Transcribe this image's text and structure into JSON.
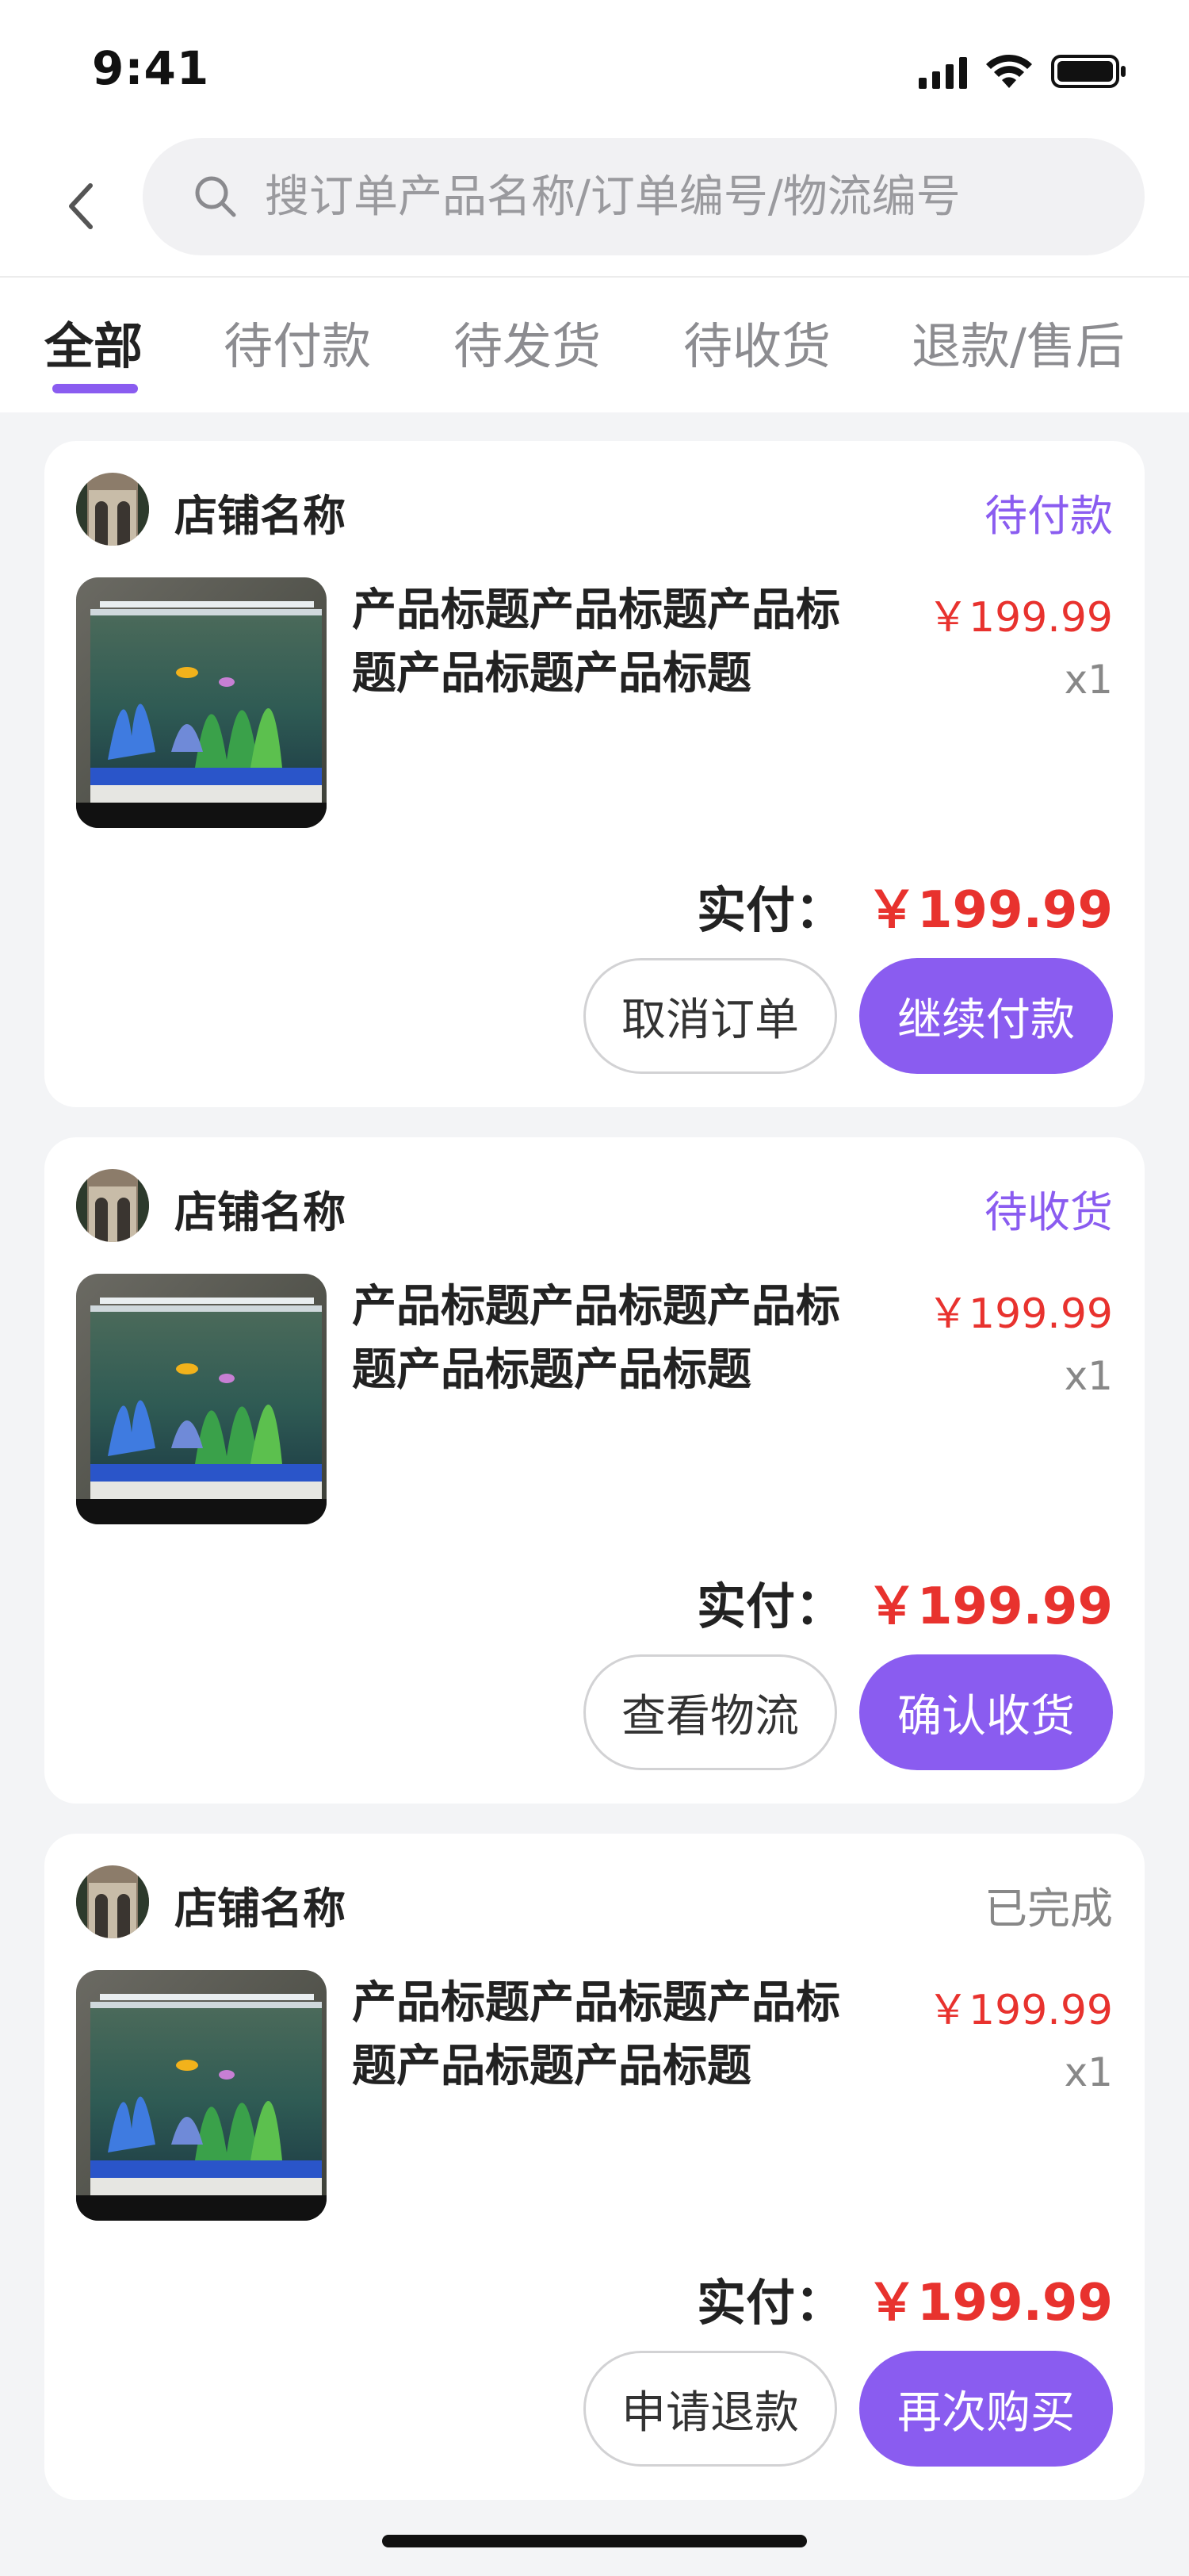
{
  "status_bar": {
    "time": "9:41"
  },
  "search": {
    "placeholder": "搜订单产品名称/订单编号/物流编号"
  },
  "tabs": [
    {
      "label": "全部",
      "active": true
    },
    {
      "label": "待付款",
      "active": false
    },
    {
      "label": "待发货",
      "active": false
    },
    {
      "label": "待收货",
      "active": false
    },
    {
      "label": "退款/售后",
      "active": false
    }
  ],
  "colors": {
    "accent": "#8a5cf0",
    "price": "#e8322e",
    "done": "#888888",
    "background": "#f3f4f6"
  },
  "orders": [
    {
      "shop_name": "店铺名称",
      "status": "待付款",
      "product_title": "产品标题产品标题产品标题产品标题产品标题",
      "price": "￥199.99",
      "qty": "x1",
      "total_label": "实付：",
      "total_value": "￥199.99",
      "secondary_button": "取消订单",
      "primary_button": "继续付款"
    },
    {
      "shop_name": "店铺名称",
      "status": "待收货",
      "product_title": "产品标题产品标题产品标题产品标题产品标题",
      "price": "￥199.99",
      "qty": "x1",
      "total_label": "实付：",
      "total_value": "￥199.99",
      "secondary_button": "查看物流",
      "primary_button": "确认收货"
    },
    {
      "shop_name": "店铺名称",
      "status": "已完成",
      "product_title": "产品标题产品标题产品标题产品标题产品标题",
      "price": "￥199.99",
      "qty": "x1",
      "total_label": "实付：",
      "total_value": "￥199.99",
      "secondary_button": "申请退款",
      "primary_button": "再次购买"
    }
  ]
}
